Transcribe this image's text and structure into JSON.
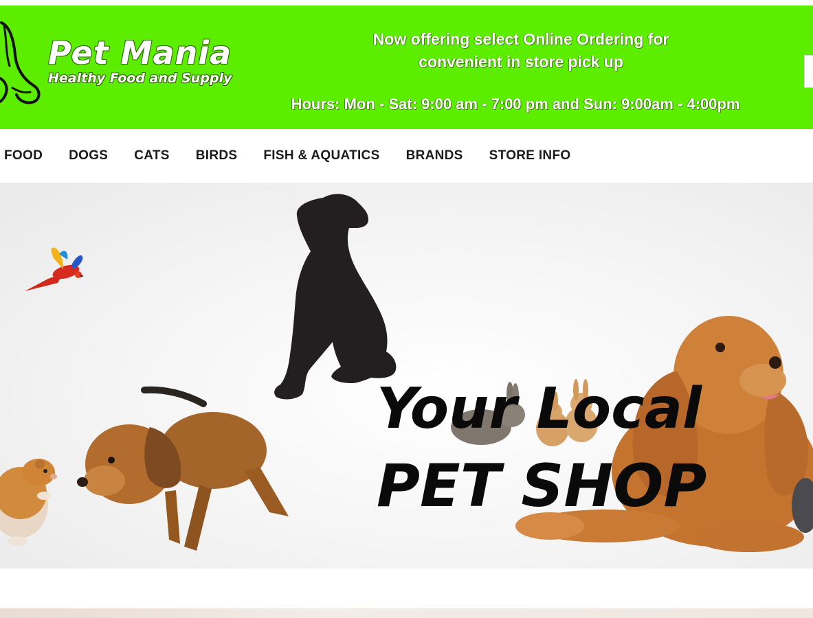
{
  "brand": {
    "name": "Pet Mania",
    "tagline": "Healthy Food and Supply",
    "color": "#5ded00"
  },
  "header": {
    "announcement": "Now offering select Online Ordering for convenient in store pick up",
    "hours": "Hours: Mon - Sat: 9:00 am - 7:00 pm and  Sun: 9:00am - 4:00pm"
  },
  "nav": {
    "items": [
      {
        "label": "FOOD"
      },
      {
        "label": "DOGS"
      },
      {
        "label": "CATS"
      },
      {
        "label": "BIRDS"
      },
      {
        "label": "FISH & AQUATICS"
      },
      {
        "label": "BRANDS"
      },
      {
        "label": "STORE INFO"
      }
    ]
  },
  "hero": {
    "headline_line1": "Your Local",
    "headline_line2": "PET SHOP",
    "animals": [
      "parrot",
      "hamster",
      "dachshund-puppy",
      "rabbits",
      "cocker-spaniel",
      "dog-silhouette"
    ]
  }
}
